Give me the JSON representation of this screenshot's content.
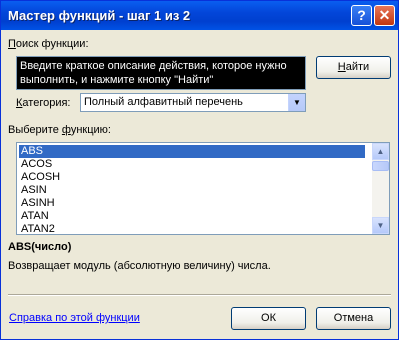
{
  "window": {
    "title": "Мастер функций - шаг 1 из 2",
    "help_button": "?",
    "close_button": "✕"
  },
  "search": {
    "label_pre": "",
    "label_hot": "П",
    "label_post": "оиск функции:",
    "value": "Введите краткое описание действия, которое нужно выполнить, и нажмите кнопку \"Найти\"",
    "find_button_pre": "",
    "find_button_hot": "Н",
    "find_button_post": "айти"
  },
  "category": {
    "label_pre": "",
    "label_hot": "К",
    "label_post": "атегория:",
    "selected": "Полный алфавитный перечень",
    "arrow": "▼"
  },
  "functions": {
    "label_pre": "Выберите ",
    "label_hot": "ф",
    "label_post": "ункцию:",
    "items": [
      "ABS",
      "ACOS",
      "ACOSH",
      "ASIN",
      "ASINH",
      "ATAN",
      "ATAN2"
    ],
    "selected_index": 0,
    "scroll_up": "▲",
    "scroll_down": "▼"
  },
  "description": {
    "signature": "ABS(число)",
    "text": "Возвращает модуль (абсолютную величину) числа."
  },
  "footer": {
    "help_link": "Справка по этой функции",
    "ok_button": "ОК",
    "cancel_button": "Отмена"
  },
  "colors": {
    "title_bar": "#0346d9",
    "selection": "#316ac5",
    "dialog_bg": "#ece9d8",
    "link": "#0000ff"
  }
}
